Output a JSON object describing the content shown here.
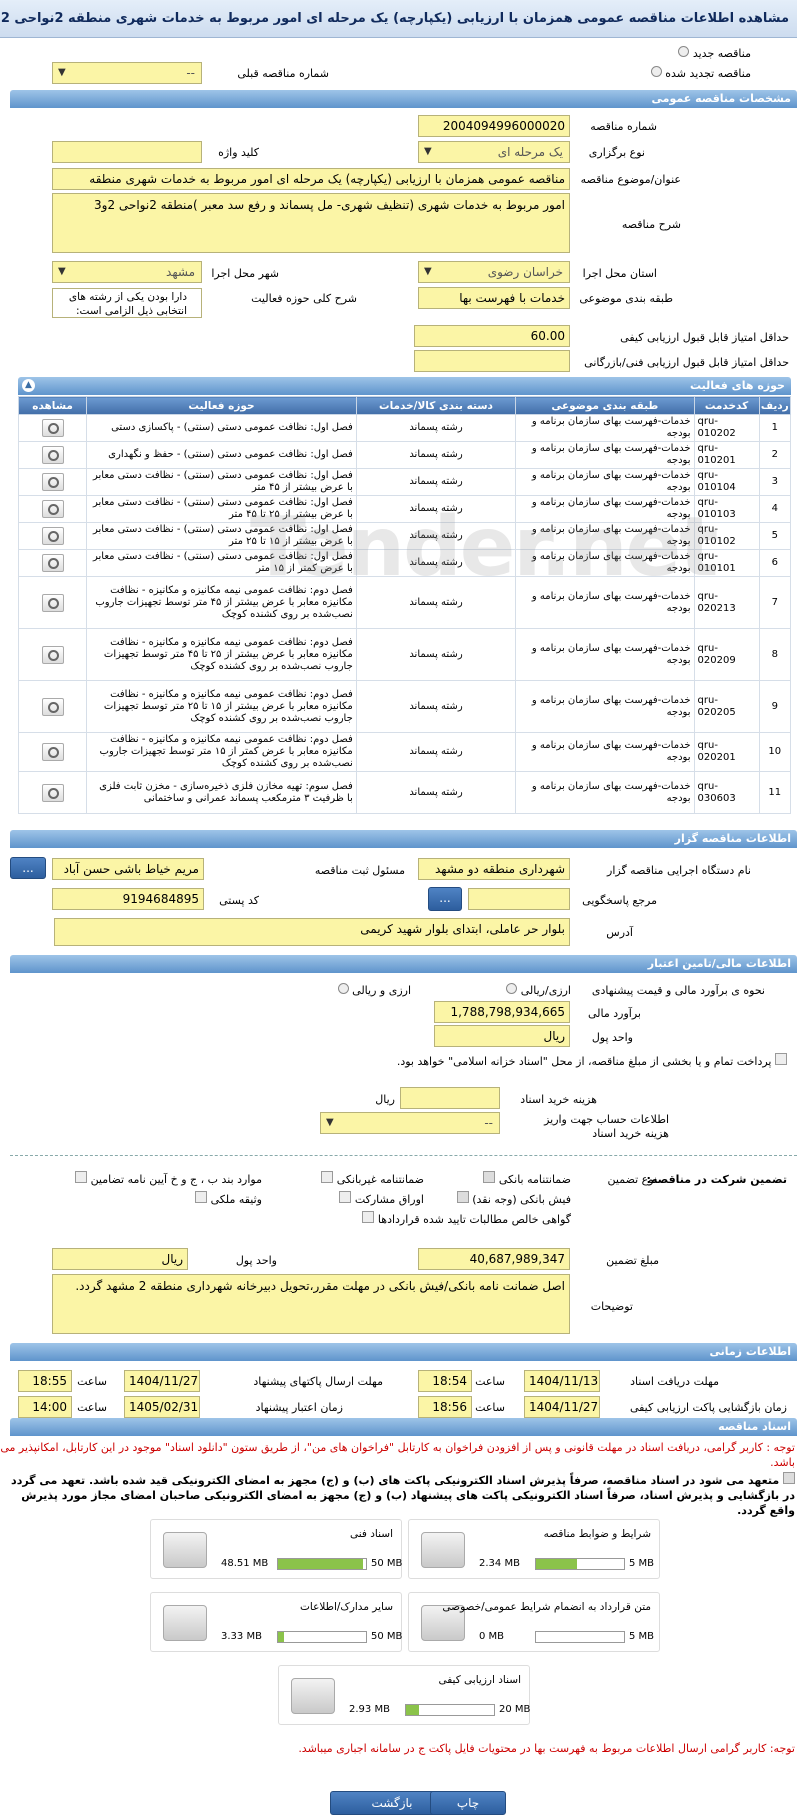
{
  "title": "مشاهده اطلاعات مناقصه عمومی همزمان با ارزیابی (یکپارچه) یک مرحله ای امور مربوط به خدمات شهری منطقه 2نواحی 2و3",
  "top": {
    "new_tender": "مناقصه جدید",
    "renewed_tender": "مناقصه تجدید شده",
    "prev_number_label": "شماره مناقصه قبلی",
    "prev_number_value": "--"
  },
  "general": {
    "header": "مشخصات مناقصه عمومی",
    "number_label": "شماره مناقصه",
    "number": "2004094996000020",
    "type_label": "نوع برگزاری",
    "type": "یک مرحله ای",
    "keyword_label": "کلید واژه",
    "subject_label": "عنوان/موضوع مناقصه",
    "subject": "مناقصه عمومی همزمان با ارزیابی (یکپارچه) یک مرحله ای امور مربوط به خدمات شهری منطقه",
    "desc_label": "شرح مناقصه",
    "desc": "امور مربوط به خدمات شهری (تنظیف شهری- مل پسماند و رفع سد معبر )منطقه 2نواحی 2و3",
    "province_label": "استان محل اجرا",
    "province": "خراسان رضوی",
    "city_label": "شهر محل اجرا",
    "city": "مشهد",
    "category_label": "طبقه بندی موضوعی",
    "category": "خدمات با فهرست بها",
    "scope_label": "شرح کلی حوزه فعالیت",
    "scope": "دارا بودن یکی از رشته های انتخابی ذیل الزامی است:",
    "min_quality_label": "حداقل امتیاز قابل قبول ارزیابی کیفی",
    "min_quality": "60.00",
    "min_tech_label": "حداقل امتیاز قابل قبول ارزیابی فنی/بازرگانی"
  },
  "activities": {
    "header": "حوزه های فعالیت",
    "columns": [
      "ردیف",
      "کدخدمت",
      "طبقه بندی موضوعی",
      "دسته بندی کالا/خدمات",
      "حوزه فعالیت",
      "مشاهده"
    ],
    "rows": [
      [
        "1",
        "qru-010202",
        "خدمات-فهرست بهای سازمان برنامه و بودجه",
        "رشته پسماند",
        "فصل اول: نظافت عمومی دستی (سنتی) - پاکسازی دستی"
      ],
      [
        "2",
        "qru-010201",
        "خدمات-فهرست بهای سازمان برنامه و بودجه",
        "رشته پسماند",
        "فصل اول: نظافت عمومی دستی (سنتی) - حفظ و نگهداری"
      ],
      [
        "3",
        "qru-010104",
        "خدمات-فهرست بهای سازمان برنامه و بودجه",
        "رشته پسماند",
        "فصل اول: نظافت عمومی دستی (سنتی) - نظافت دستی معابر با عرض بیشتر از ۴۵ متر"
      ],
      [
        "4",
        "qru-010103",
        "خدمات-فهرست بهای سازمان برنامه و بودجه",
        "رشته پسماند",
        "فصل اول: نظافت عمومی دستی (سنتی) - نظافت دستی معابر با عرض بیشتر از ۲۵ تا ۴۵ متر"
      ],
      [
        "5",
        "qru-010102",
        "خدمات-فهرست بهای سازمان برنامه و بودجه",
        "رشته پسماند",
        "فصل اول: نظافت عمومی دستی (سنتی) - نظافت دستی معابر با عرض بیشتر از ۱۵ تا ۲۵ متر"
      ],
      [
        "6",
        "qru-010101",
        "خدمات-فهرست بهای سازمان برنامه و بودجه",
        "رشته پسماند",
        "فصل اول: نظافت عمومی دستی (سنتی) - نظافت دستی معابر با عرض کمتر از ۱۵ متر"
      ],
      [
        "7",
        "qru-020213",
        "خدمات-فهرست بهای سازمان برنامه و بودجه",
        "رشته پسماند",
        "فصل دوم: نظافت عمومی نیمه مکانیزه و مکانیزه - نظافت مکانیزه معابر با عرض بیشتر از ۴۵ متر توسط تجهیزات جاروب نصب‌شده بر روی کشنده کوچک"
      ],
      [
        "8",
        "qru-020209",
        "خدمات-فهرست بهای سازمان برنامه و بودجه",
        "رشته پسماند",
        "فصل دوم: نظافت عمومی نیمه مکانیزه و مکانیزه - نظافت مکانیزه معابر با عرض بیشتر از ۲۵ تا ۴۵ متر توسط تجهیزات جاروب نصب‌شده بر روی کشنده کوچک"
      ],
      [
        "9",
        "qru-020205",
        "خدمات-فهرست بهای سازمان برنامه و بودجه",
        "رشته پسماند",
        "فصل دوم: نظافت عمومی نیمه مکانیزه و مکانیزه - نظافت مکانیزه معابر با عرض بیشتر از ۱۵ تا ۲۵ متر توسط تجهیزات جاروب نصب‌شده بر روی کشنده کوچک"
      ],
      [
        "10",
        "qru-020201",
        "خدمات-فهرست بهای سازمان برنامه و بودجه",
        "رشته پسماند",
        "فصل دوم: نظافت عمومی نیمه مکانیزه و مکانیزه - نظافت مکانیزه معابر با عرض کمتر از ۱۵ متر توسط تجهیزات جاروب نصب‌شده بر روی کشنده کوچک"
      ],
      [
        "11",
        "qru-030603",
        "خدمات-فهرست بهای سازمان برنامه و بودجه",
        "رشته پسماند",
        "فصل سوم: تهیه مخازن فلزی ذخیره‌سازی - مخزن ثابت فلزی با ظرفیت ۳ مترمکعب پسماند عمرانی و ساختمانی"
      ]
    ]
  },
  "organizer": {
    "header": "اطلاعات مناقصه گزار",
    "org_label": "نام دستگاه اجرایی مناقصه گزار",
    "org": "شهرداری منطقه دو مشهد",
    "resp_label": "مسئول ثبت مناقصه",
    "resp": "مریم خیاط باشی حسن آباد",
    "btn": "...",
    "ref_label": "مرجع پاسخگویی",
    "postal_label": "کد پستی",
    "postal": "9194684895",
    "address_label": "آدرس",
    "address": "بلوار حر عاملی، ابتدای بلوار شهید کریمی"
  },
  "finance": {
    "header": "اطلاعات مالی/تامین اعتبار",
    "method_label": "نحوه ی برآورد مالی و قیمت پیشنهادی",
    "opt1": "ارزی/ریالی",
    "opt2": "ارزی و ریالی",
    "estimate_label": "برآورد مالی",
    "estimate": "1,788,798,934,665",
    "currency_label": "واحد پول",
    "currency": "ریال",
    "treasury": "پرداخت تمام و یا بخشی از مبلغ مناقصه، از محل \"اسناد خزانه اسلامی\" خواهد بود.",
    "doc_cost_label": "هزینه خرید اسناد",
    "doc_cost_unit": "ریال",
    "acct_label": "اطلاعات حساب جهت واریز هزینه خرید اسناد",
    "acct": "--"
  },
  "guarantee": {
    "title": "تضمین شرکت در مناقصه:",
    "kind_label": "نوع تضمین",
    "items": [
      "ضمانتنامه بانکی",
      "ضمانتنامه غیربانکی",
      "موارد بند ب ، ج و خ آیین نامه تضامین",
      "فیش بانکی (وجه نقد)",
      "اوراق مشارکت",
      "وثیقه ملکی",
      "گواهی خالص مطالبات تایید شده قراردادها"
    ],
    "amount_label": "مبلغ تضمین",
    "amount": "40,687,989,347",
    "unit_label": "واحد پول",
    "unit": "ریال",
    "notes_label": "توضیحات",
    "notes": "اصل ضمانت نامه بانکی/فیش بانکی در مهلت مقرر،تحویل دبیرخانه شهرداری منطقه 2 مشهد گردد."
  },
  "timing": {
    "header": "اطلاعات زمانی",
    "doc_deadline_label": "مهلت دریافت اسناد",
    "doc_deadline_date": "1404/11/13",
    "doc_deadline_time": "18:54",
    "send_deadline_label": "مهلت ارسال پاکتهای پیشنهاد",
    "send_deadline_date": "1404/11/27",
    "send_deadline_time": "18:55",
    "quality_open_label": "زمان بازگشایی پاکت ارزیابی کیفی",
    "quality_open_date": "1404/11/27",
    "quality_open_time": "18:56",
    "validity_label": "زمان اعتبار پیشنهاد",
    "validity_date": "1405/02/31",
    "validity_time": "14:00",
    "time_label": "ساعت"
  },
  "docs": {
    "header": "اسناد مناقصه",
    "notice": "توجه : کاربر گرامی، دریافت اسناد در مهلت قانونی و پس از افزودن فراخوان به کارتابل \"فراخوان های من\"، از طریق ستون \"دانلود اسناد\" موجود در این کارتابل، امکانپذیر می باشد.",
    "commit": "متعهد می شود در اسناد مناقصه، صرفاً پذیرش اسناد الکترونیکی پاکت های (ب) و (ج) مجهز به امضای الکترونیکی قید شده باشد. تعهد می گردد در بازگشایی و پذیرش اسناد، صرفاً اسناد الکترونیکی پاکت های پیشنهاد (ب) و (ج) مجهز به امضای الکترونیکی صاحبان امضای مجاز مورد پذیرش واقع گردد.",
    "items": [
      {
        "name": "شرایط و ضوابط مناقصه",
        "used": "2.34 MB",
        "max": "5 MB",
        "fill": 0.47
      },
      {
        "name": "اسناد فنی",
        "used": "48.51 MB",
        "max": "50 MB",
        "fill": 0.97
      },
      {
        "name": "متن قرارداد به انضمام شرایط عمومی/خصوصی",
        "used": "0 MB",
        "max": "5 MB",
        "fill": 0
      },
      {
        "name": "سایر مدارک/اطلاعات",
        "used": "3.33 MB",
        "max": "50 MB",
        "fill": 0.07
      },
      {
        "name": "اسناد ارزیابی کیفی",
        "used": "2.93 MB",
        "max": "20 MB",
        "fill": 0.15
      }
    ],
    "footer_note": "توجه: کاربر گرامی ارسال اطلاعات مربوط به فهرست بها در محتویات فایل پاکت ج در سامانه اجباری میباشد."
  },
  "buttons": {
    "back": "بازگشت",
    "print": "چاپ"
  },
  "watermark": "Tender.net"
}
